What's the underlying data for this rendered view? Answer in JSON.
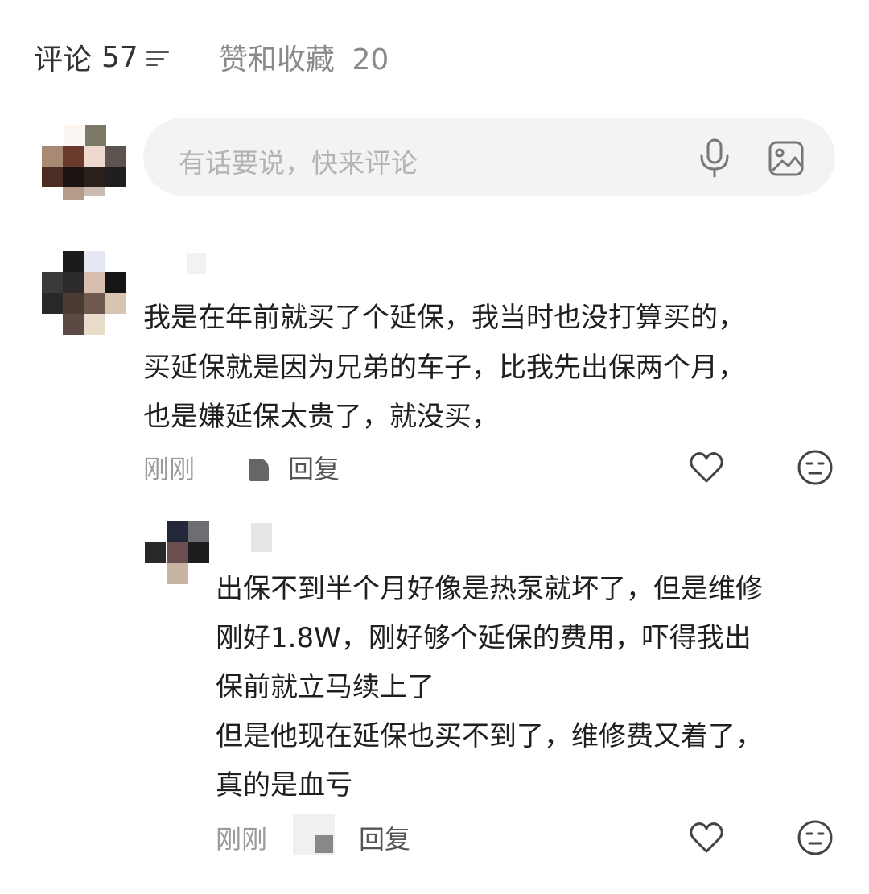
{
  "tabs": {
    "comments_label": "评论",
    "comments_count": "57",
    "likes_label": "赞和收藏",
    "likes_count": "20"
  },
  "composer": {
    "placeholder": "有话要说，快来评论"
  },
  "comments": [
    {
      "lines": [
        "我是在年前就买了个延保，我当时也没打算买的，",
        "买延保就是因为兄弟的车子，比我先出保两个月，",
        "也是嫌延保太贵了，就没买，"
      ],
      "time": "刚刚",
      "reply_label": "回复"
    }
  ],
  "replies": [
    {
      "lines": [
        "出保不到半个月好像是热泵就坏了，但是维修",
        "刚好1.8W，刚好够个延保的费用，吓得我出",
        "保前就立马续上了",
        "但是他现在延保也买不到了，维修费又着了，",
        "真的是血亏"
      ],
      "time": "刚刚",
      "reply_label": "回复"
    }
  ],
  "icons": {
    "sort": "sort-filter-icon",
    "mic": "microphone-icon",
    "image": "image-icon",
    "like": "heart-icon",
    "react": "neutral-face-icon"
  },
  "colors": {
    "primary_text": "#1f1f1f",
    "secondary_text": "#9a9a9a",
    "input_bg": "#f3f3f3"
  }
}
